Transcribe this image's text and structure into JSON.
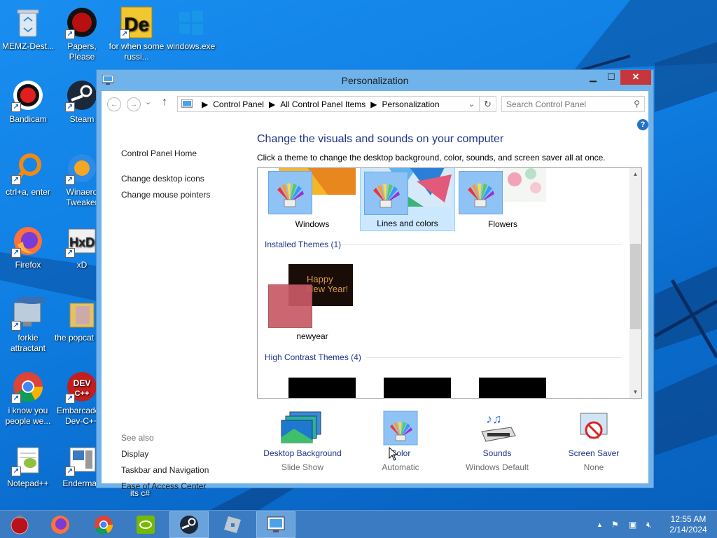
{
  "desktop": {
    "icons": [
      {
        "label": "MEMZ-Dest...",
        "icon": "recycle-bin-icon"
      },
      {
        "label": "Papers, Please",
        "icon": "papers-please-icon"
      },
      {
        "label": "for when some russi...",
        "icon": "de-icon"
      },
      {
        "label": "windows.exe",
        "icon": "windows-exe-icon"
      },
      {
        "label": "Bandicam",
        "icon": "bandicam-icon"
      },
      {
        "label": "Steam",
        "icon": "steam-icon"
      },
      {
        "label": "ctrl+a, enter",
        "icon": "ring-icon"
      },
      {
        "label": "Winaero Tweaker",
        "icon": "winaero-icon"
      },
      {
        "label": "Firefox",
        "icon": "firefox-icon"
      },
      {
        "label": "xD",
        "icon": "hxd-icon"
      },
      {
        "label": "forkie attractant",
        "icon": "fish-icon"
      },
      {
        "label": "the popcat shit",
        "icon": "folder-icon"
      },
      {
        "label": "i know you people we...",
        "icon": "chrome-icon"
      },
      {
        "label": "Embarcadero Dev-C++",
        "icon": "devcpp-icon"
      },
      {
        "label": "Notepad++",
        "icon": "notepadpp-icon"
      },
      {
        "label": "Enderman",
        "icon": "enderman-icon"
      },
      {
        "label": "its c#",
        "icon": "file-icon"
      }
    ]
  },
  "window": {
    "title": "Personalization",
    "address": {
      "crumbs": [
        "Control Panel",
        "All Control Panel Items",
        "Personalization"
      ]
    },
    "search": {
      "placeholder": "Search Control Panel"
    },
    "left_pane": {
      "home": "Control Panel Home",
      "links": [
        "Change desktop icons",
        "Change mouse pointers"
      ],
      "see_also": "See also",
      "see_also_links": [
        "Display",
        "Taskbar and Navigation",
        "Ease of Access Center"
      ]
    },
    "heading": "Change the visuals and sounds on your computer",
    "subheading": "Click a theme to change the desktop background, color, sounds, and screen saver all at once.",
    "themes": {
      "default": [
        "Windows",
        "Lines and colors",
        "Flowers"
      ],
      "selected": "Lines and colors",
      "installed_header": "Installed Themes (1)",
      "installed": [
        "newyear"
      ],
      "newyear_preview_text": [
        "Happy",
        "New Year!"
      ],
      "high_contrast_header": "High Contrast Themes (4)"
    },
    "bottom": [
      {
        "title": "Desktop Background",
        "sub": "Slide Show"
      },
      {
        "title": "Color",
        "sub": "Automatic"
      },
      {
        "title": "Sounds",
        "sub": "Windows Default"
      },
      {
        "title": "Screen Saver",
        "sub": "None"
      }
    ]
  },
  "taskbar": {
    "time": "12:55 AM",
    "date": "2/14/2024"
  }
}
